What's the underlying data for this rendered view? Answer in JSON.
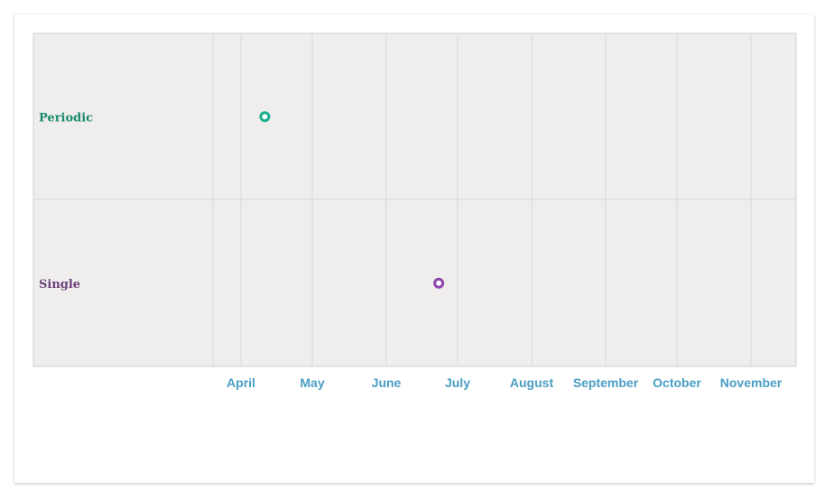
{
  "chart_data": {
    "type": "scatter",
    "title": "",
    "xlabel": "",
    "ylabel": "",
    "x_axis": "time",
    "x_ticks": [
      "April",
      "May",
      "June",
      "July",
      "August",
      "September",
      "October",
      "November"
    ],
    "rows": [
      {
        "name": "Periodic",
        "color": "#1aaf8f"
      },
      {
        "name": "Single",
        "color": "#8e44ad"
      }
    ],
    "points": [
      {
        "row": "Periodic",
        "x": "2020-04-11",
        "color": "#1aaf8f"
      },
      {
        "row": "Single",
        "x": "2020-06-23",
        "color": "#8e44ad"
      }
    ],
    "grid": true,
    "legend": "none"
  },
  "colors": {
    "plot_background": "#efeeed",
    "grid": "#d8d8d8",
    "tick_label": "#4a9ec4",
    "periodic_label": "#1a8a6e",
    "single_label": "#6b3f7a"
  }
}
